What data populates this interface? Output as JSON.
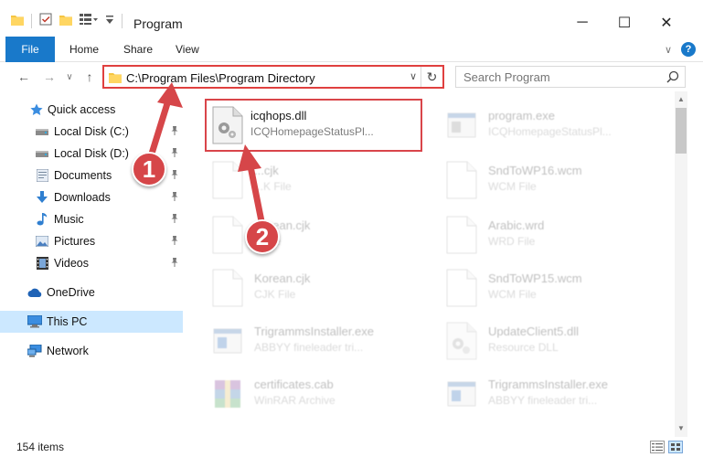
{
  "window": {
    "title": "Program",
    "min_glyph": "─",
    "max_glyph": "☐",
    "close_glyph": "✕"
  },
  "ribbon": {
    "tabs": [
      "File",
      "Home",
      "Share",
      "View"
    ],
    "expand_glyph": "∨",
    "help_glyph": "?"
  },
  "address": {
    "path": "C:\\Program Files\\Program Directory",
    "dropdown_glyph": "∨",
    "refresh_glyph": "↻",
    "back_glyph": "←",
    "forward_glyph": "→",
    "recent_glyph": "∨",
    "up_glyph": "↑"
  },
  "search": {
    "placeholder": "Search Program"
  },
  "sidebar": {
    "items": [
      {
        "label": "Quick access",
        "icon": "star-icon"
      },
      {
        "label": "Local Disk (C:)",
        "icon": "drive-icon"
      },
      {
        "label": "Local Disk (D:)",
        "icon": "drive-icon"
      },
      {
        "label": "Documents",
        "icon": "documents-icon"
      },
      {
        "label": "Downloads",
        "icon": "download-icon"
      },
      {
        "label": "Music",
        "icon": "music-icon"
      },
      {
        "label": "Pictures",
        "icon": "pictures-icon"
      },
      {
        "label": "Videos",
        "icon": "videos-icon"
      },
      {
        "label": "OneDrive",
        "icon": "cloud-icon"
      },
      {
        "label": "This PC",
        "icon": "computer-icon"
      },
      {
        "label": "Network",
        "icon": "network-icon"
      }
    ],
    "pin_glyph": "📌"
  },
  "files": [
    {
      "name": "icqhops.dll",
      "type": "ICQHomepageStatusPl...",
      "icon": "dll-gear-icon"
    },
    {
      "name": "program.exe",
      "type": "ICQHomepageStatusPl...",
      "icon": "exe-icon"
    },
    {
      "name": "...cjk",
      "type": "...K File",
      "icon": "blank-file-icon"
    },
    {
      "name": "SndToWP16.wcm",
      "type": "WCM File",
      "icon": "blank-file-icon"
    },
    {
      "name": "Korean.cjk",
      "type": "...File",
      "icon": "blank-file-icon"
    },
    {
      "name": "Arabic.wrd",
      "type": "WRD File",
      "icon": "blank-file-icon"
    },
    {
      "name": "Korean.cjk",
      "type": "CJK File",
      "icon": "blank-file-icon"
    },
    {
      "name": "SndToWP15.wcm",
      "type": "WCM File",
      "icon": "blank-file-icon"
    },
    {
      "name": "TrigrammsInstaller.exe",
      "type": "ABBYY fineleader tri...",
      "icon": "exe-icon"
    },
    {
      "name": "UpdateClient5.dll",
      "type": "Resource DLL",
      "icon": "dll-gear-icon"
    },
    {
      "name": "certificates.cab",
      "type": "WinRAR Archive",
      "icon": "archive-icon"
    },
    {
      "name": "TrigrammsInstaller.exe",
      "type": "ABBYY fineleader tri...",
      "icon": "exe-icon"
    }
  ],
  "status": {
    "count": "154 items"
  },
  "annotations": {
    "step1": "1",
    "step2": "2"
  },
  "colors": {
    "accent": "#1979ca",
    "highlight": "#d9454a",
    "selection": "#cce8ff",
    "folder": "#f5c542"
  }
}
